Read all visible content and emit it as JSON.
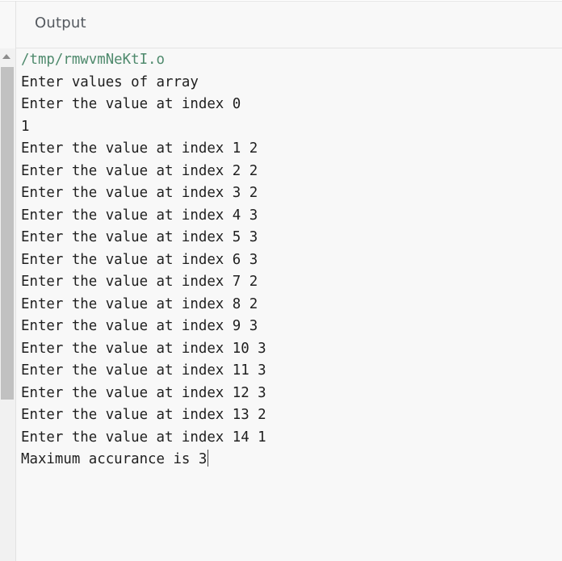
{
  "panel": {
    "title": "Output"
  },
  "console": {
    "path": "/tmp/rmwvmNeKtI.o",
    "lines": [
      "Enter values of array",
      "Enter the value at index 0",
      "1",
      "Enter the value at index 1 2",
      "Enter the value at index 2 2",
      "Enter the value at index 3 2",
      "Enter the value at index 4 3",
      "Enter the value at index 5 3",
      "Enter the value at index 6 3",
      "Enter the value at index 7 2",
      "Enter the value at index 8 2",
      "Enter the value at index 9 3",
      "Enter the value at index 10 3",
      "Enter the value at index 11 3",
      "Enter the value at index 12 3",
      "Enter the value at index 13 2",
      "Enter the value at index 14 1"
    ],
    "result": "Maximum accurance is 3"
  },
  "colors": {
    "path_text": "#4f8a6d",
    "output_text": "#1f1f1f",
    "background": "#f8f8f8"
  }
}
